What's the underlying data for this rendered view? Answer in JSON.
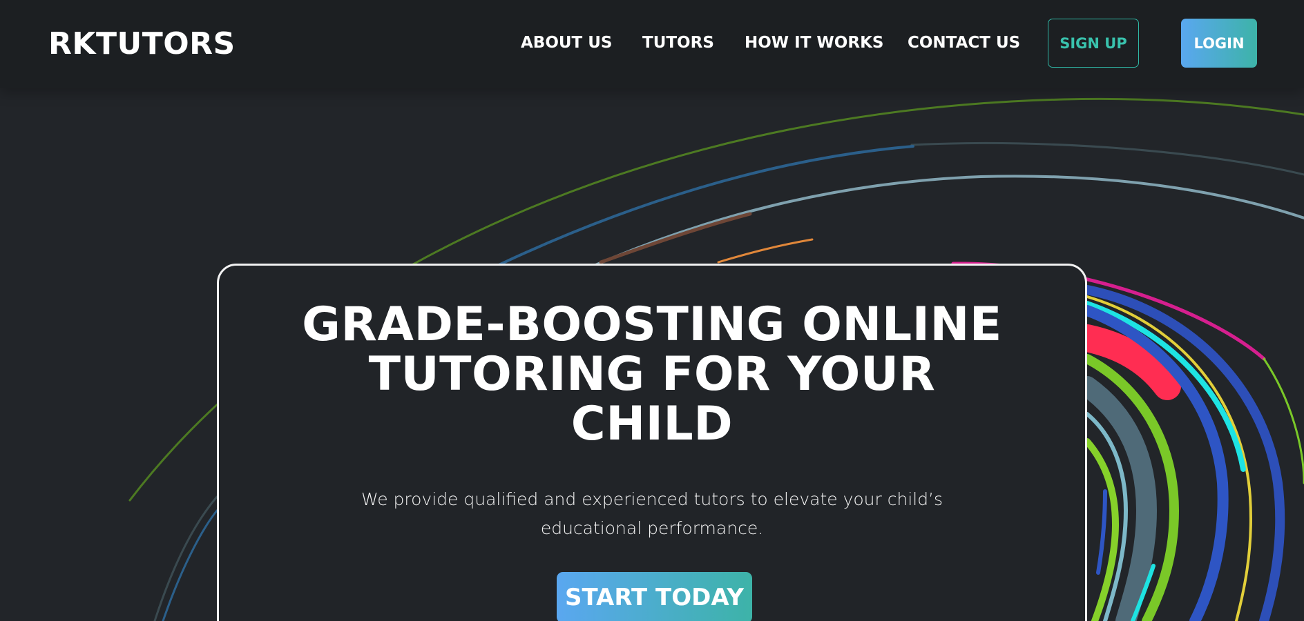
{
  "header": {
    "brand": "RKTUTORS",
    "nav": {
      "about": "ABOUT US",
      "tutors": "TUTORS",
      "how_it_works": "HOW IT WORKS",
      "contact": "CONTACT US"
    },
    "signup_label": "SIGN UP",
    "login_label": "LOGIN"
  },
  "hero": {
    "title_lines": [
      "GRADE-BOOSTING ONLINE",
      "TUTORING FOR YOUR",
      "CHILD"
    ],
    "subtitle_lines": [
      "We provide qualified and experienced tutors to elevate your child’s",
      "educational performance."
    ],
    "cta_label": "START TODAY"
  },
  "colors": {
    "background": "#222529",
    "navbar": "#1c1f22",
    "accent_teal": "#39c2ad",
    "accent_blue": "#5aa7f0"
  }
}
